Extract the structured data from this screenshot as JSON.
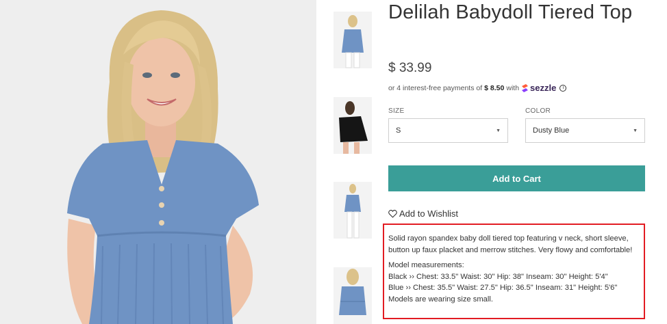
{
  "product": {
    "title": "Delilah Babydoll Tiered Top",
    "price": "$ 33.99",
    "installments": {
      "prefix": "or 4 interest-free payments of",
      "amount": "$ 8.50",
      "with": "with",
      "provider": "sezzle"
    }
  },
  "options": {
    "size": {
      "label": "SIZE",
      "value": "S"
    },
    "color": {
      "label": "COLOR",
      "value": "Dusty Blue"
    }
  },
  "actions": {
    "add_to_cart": "Add to Cart",
    "wishlist": "Add to Wishlist"
  },
  "description": {
    "summary": "Solid rayon spandex baby doll tiered top featuring v neck, short sleeve, button up faux placket and merrow stitches. Very flowy and comfortable!",
    "measurements_title": "Model measurements:",
    "black_line": "Black ›› Chest: 33.5\" Waist: 30\" Hip: 38\" Inseam: 30\" Height: 5'4\"",
    "blue_line": "Blue ›› Chest: 35.5\" Waist: 27.5\" Hip: 36.5\" Inseam: 31\" Height: 5'6\"",
    "size_note": "Models are wearing size small."
  },
  "colors": {
    "accent": "#3a9e98",
    "highlight_border": "#e21b22",
    "garment_blue": "#6f93c4",
    "sezzle_purple": "#392558"
  }
}
